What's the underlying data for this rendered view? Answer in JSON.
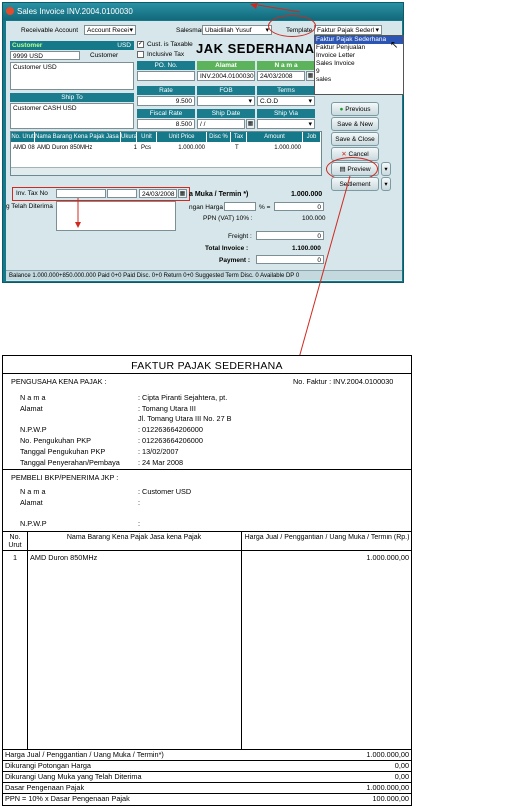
{
  "window": {
    "title": "Sales Invoice INV.2004.0100030",
    "receivable_label": "Receivable Account",
    "receivable_value": "Account Recei",
    "salesman_label": "Salesman",
    "salesman_value": "Ubaidillah Yusuf",
    "template_label": "Template",
    "template_value": "Faktur Pajak Sederl",
    "template_options": [
      "Faktur Pajak Sederhana",
      "Faktur Penjualan",
      "Invoice Letter",
      "Sales Invoice",
      "9",
      "sales"
    ],
    "big_title": "JAK SEDERHANA",
    "customer_header": "Customer",
    "currency": "USD",
    "customer_code": "9999 USD",
    "customer_role": "Customer",
    "customer_name": "Customer USD",
    "cust_taxable": "Cust. is Taxable",
    "inclusive_tax": "Inclusive Tax",
    "po_no_label": "PO. No.",
    "alamat_label": "Alamat",
    "nama_label": "N a m a",
    "alamat_value": "INV.2004.0100030",
    "date_value": "24/03/2008",
    "ship_to_label": "Ship To",
    "ship_to_value": "Customer CASH USD",
    "rate_label": "Rate",
    "rate_value": "9.500",
    "fob_label": "FOB",
    "terms_label": "Terms",
    "terms_value": "C.O.D",
    "fiscal_rate_label": "Fiscal Rate",
    "fiscal_rate_value": "8.500",
    "ship_date_label": "Ship Date",
    "ship_date_value": "/ /",
    "ship_via_label": "Ship Via",
    "grid_headers": [
      "No. Urut",
      "Nama Barang Kena Pajak Jasa Kena P",
      "Ukuran",
      "Unit",
      "Unit Price",
      "Disc %",
      "Tax",
      "Amount",
      "Job"
    ],
    "grid_row": [
      "AMD 0850",
      "AMD Duron 850MHz",
      "1",
      "Pcs",
      "1.000.000",
      "",
      "T",
      "1.000.000",
      ""
    ],
    "buttons": {
      "previous": "Previous",
      "save_new": "Save & New",
      "save_close": "Save & Close",
      "cancel": "Cancel",
      "preview": "Preview",
      "settlement": "Settlement"
    },
    "inv_tax_label": "Inv. Tax No",
    "inv_tax_date": "24/03/2008",
    "telah_diterima": "g Telah Diterima",
    "uang_muka_label": "a Muka / Termin *)",
    "uang_muka_value": "1.000.000",
    "potongan_label": "ngan Harga",
    "percent_label": "% =",
    "potongan_value": "0",
    "ppn_label": "PPN (VAT) 10%  :",
    "ppn_value": "100.000",
    "freight_label": "Freight :",
    "freight_value": "0",
    "total_label": "Total Invoice :",
    "total_value": "1.100.000",
    "payment_label": "Payment :",
    "payment_value": "0",
    "status_bar": "Balance 1.000.000+850.000.000   Paid 0+0   Paid Disc. 0+0   Return 0+0   Suggested Term Disc. 0   Available DP 0"
  },
  "document": {
    "title": "FAKTUR PAJAK SEDERHANA",
    "pkp_label": "PENGUSAHA KENA PAJAK :",
    "no_faktur": "No. Faktur : INV.2004.0100030",
    "seller": [
      {
        "label": "N a m a",
        "value": ": Cipta Piranti Sejahtera, pt."
      },
      {
        "label": "Alamat",
        "value": ": Tomang Utara III"
      },
      {
        "label": "",
        "value": "  Jl. Tomang Utara III No. 27 B"
      },
      {
        "label": "N.P.W.P",
        "value": ": 012263664206000"
      },
      {
        "label": "No. Pengukuhan PKP",
        "value": ": 012263664206000"
      },
      {
        "label": "Tanggal Pengukuhan PKP",
        "value": ": 13/02/2007"
      },
      {
        "label": "Tanggal Penyerahan/Pembaya",
        "value": ": 24 Mar 2008"
      }
    ],
    "buyer_label": "PEMBELI BKP/PENERIMA JKP :",
    "buyer": [
      {
        "label": "N a m a",
        "value": ": Customer USD"
      },
      {
        "label": "Alamat",
        "value": ":"
      },
      {
        "label": "N.P.W.P",
        "value": ":"
      }
    ],
    "col_no": "No. Urut",
    "col_name": "Nama Barang Kena Pajak Jasa kena Pajak",
    "col_price": "Harga Jual / Penggantian / Uang Muka / Termin (Rp.)",
    "item_no": "1",
    "item_name": "AMD Duron 850MHz",
    "item_price": "1.000.000,00",
    "summary": [
      {
        "label": "Harga Jual / Penggantian / Uang Muka / Termin*)",
        "value": "1.000.000,00"
      },
      {
        "label": "Dikurangi Potongan Harga",
        "value": "0,00"
      },
      {
        "label": "Dikurangi Uang Muka yang Telah Diterima",
        "value": "0,00"
      },
      {
        "label": "Dasar Pengenaan Pajak",
        "value": "1.000.000,00"
      },
      {
        "label": "PPN = 10% x Dasar Pengenaan Pajak",
        "value": "100.000,00"
      }
    ]
  }
}
